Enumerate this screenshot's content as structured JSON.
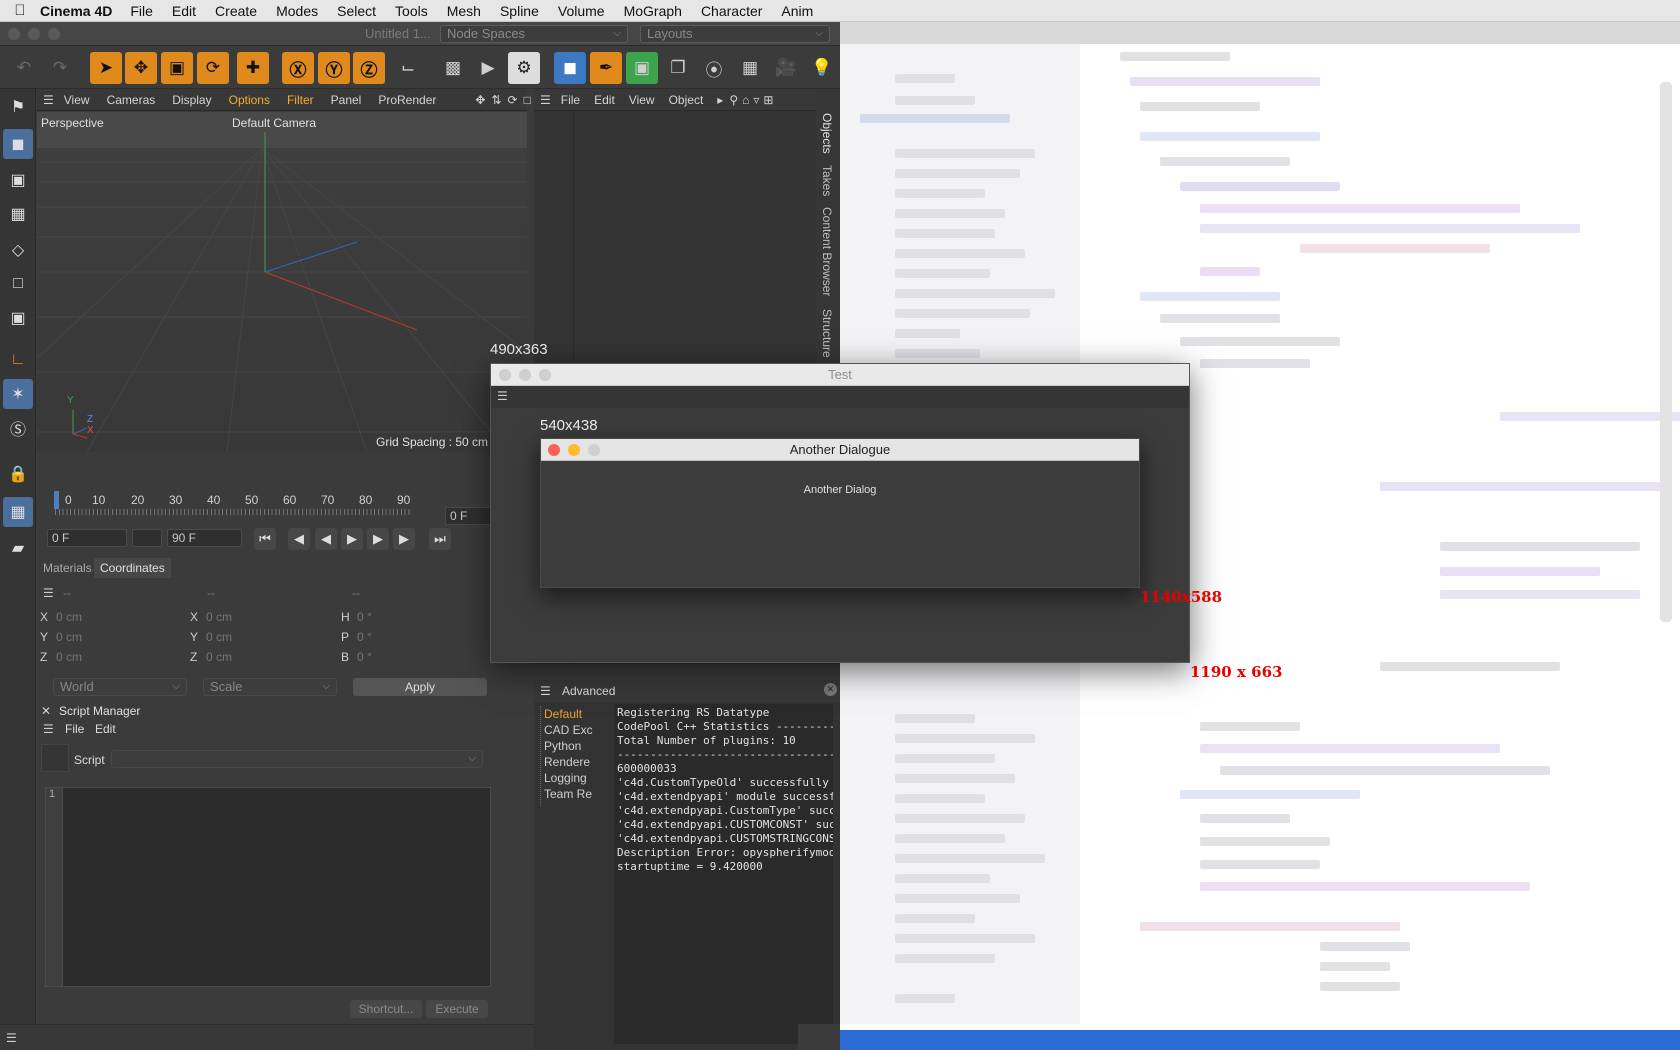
{
  "menubar": {
    "app": "Cinema 4D",
    "items": [
      "File",
      "Edit",
      "Create",
      "Modes",
      "Select",
      "Tools",
      "Mesh",
      "Spline",
      "Volume",
      "MoGraph",
      "Character",
      "Anim"
    ]
  },
  "window": {
    "title": "Untitled 1...",
    "node_spaces": "Node Spaces",
    "layouts": "Layouts"
  },
  "viewport": {
    "menu": [
      "View",
      "Cameras",
      "Display",
      "Options",
      "Filter",
      "Panel",
      "ProRender"
    ],
    "label": "Perspective",
    "camera": "Default Camera",
    "grid_spacing": "Grid Spacing : 50 cm",
    "axis_y": "Y",
    "axis_z": "Z",
    "axis_x": "X"
  },
  "timeline": {
    "ticks": [
      "0",
      "10",
      "20",
      "30",
      "40",
      "50",
      "60",
      "70",
      "80",
      "90"
    ],
    "current_frame": "0 F",
    "start": "0 F",
    "end": "90 F"
  },
  "coords": {
    "tabs": [
      "Materials",
      "Coordinates"
    ],
    "headers": [
      "--",
      "--",
      "--"
    ],
    "rows": [
      {
        "a": "X",
        "av": "0 cm",
        "b": "X",
        "bv": "0 cm",
        "c": "H",
        "cv": "0 °"
      },
      {
        "a": "Y",
        "av": "0 cm",
        "b": "Y",
        "bv": "0 cm",
        "c": "P",
        "cv": "0 °"
      },
      {
        "a": "Z",
        "av": "0 cm",
        "b": "Z",
        "bv": "0 cm",
        "c": "B",
        "cv": "0 °"
      }
    ],
    "space": "World",
    "mode": "Scale",
    "apply": "Apply"
  },
  "script_manager": {
    "title": "Script Manager",
    "menu": [
      "File",
      "Edit"
    ],
    "script_label": "Script",
    "line1": "1",
    "shortcut": "Shortcut...",
    "execute": "Execute"
  },
  "object_manager": {
    "menu": [
      "File",
      "Edit",
      "View",
      "Object"
    ],
    "vtabs": [
      "Objects",
      "Takes",
      "Content Browser",
      "Structure"
    ]
  },
  "console": {
    "title": "Advanced",
    "tree": [
      "Default",
      "CAD Exc",
      "Python",
      "Rendere",
      "Logging",
      "Team Re"
    ],
    "lines": [
      "Registering RS Datatype",
      "CodePool C++ Statistics ---------",
      "Total Number of plugins: 10",
      "---------------------------------",
      "600000033",
      "'c4d.CustomTypeOld' successfully",
      "'c4d.extendpyapi' module successf",
      "'c4d.extendpyapi.CustomType' succ",
      "'c4d.extendpyapi.CUSTOMCONST' suc",
      "'c4d.extendpyapi.CUSTOMSTRINGCONS",
      "Description Error: opyspherifymod",
      "startuptime = 9.420000"
    ]
  },
  "dialogs": {
    "test_title": "Test",
    "test_size": "490x363",
    "another_title": "Another Dialogue",
    "another_size": "540x438",
    "another_body": "Another Dialog",
    "label_1140": "1140x588",
    "label_1190": "1190 x 663"
  },
  "colors": {
    "accent": "#e08a1e",
    "highlight_menu": "#f0b030",
    "close_red": "#fe5f57",
    "min_yellow": "#febc2e",
    "annotation_red": "#e60000"
  }
}
